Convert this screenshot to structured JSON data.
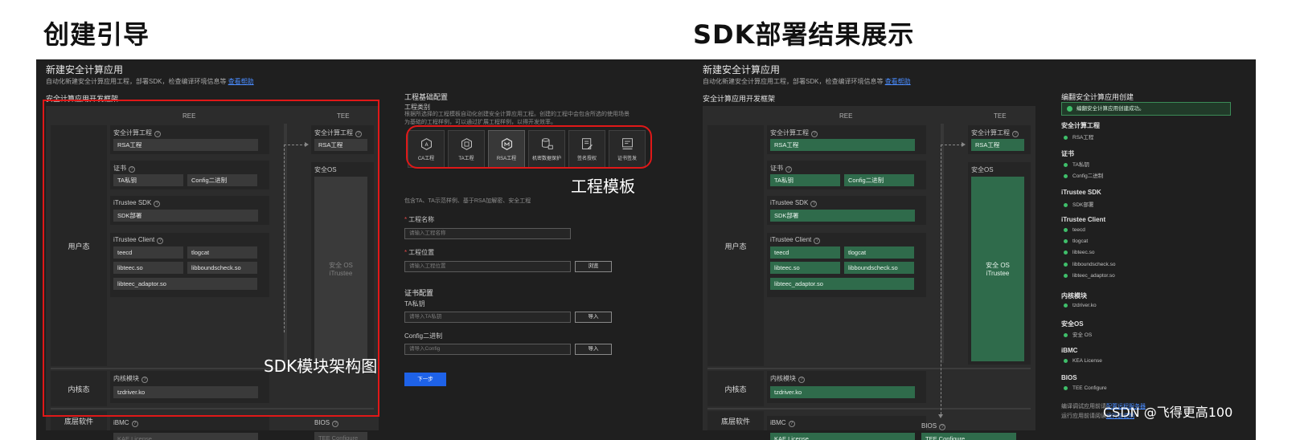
{
  "headings": {
    "left": "创建引导",
    "right": "SDK部署结果展示"
  },
  "dialog": {
    "title": "新建安全计算应用",
    "desc": "自动化新建安全计算应用工程，部署SDK，检查编译环境信息等",
    "help_link": "查看帮助",
    "framework_title": "安全计算应用开发框架"
  },
  "framework": {
    "ree": "REE",
    "tee": "TEE",
    "rows": {
      "user": "用户态",
      "kernel": "内核态",
      "base": "底层软件"
    },
    "labels": {
      "app_project": "安全计算工程",
      "cert": "证书",
      "sdk": "iTrustee SDK",
      "client": "iTrustee Client",
      "kernel_module": "内核模块",
      "ibmc": "iBMC",
      "tee_app_project": "安全计算工程",
      "secure_os": "安全OS",
      "bios": "BIOS"
    },
    "values": {
      "rsa": "RSA工程",
      "ta_private_key": "TA私钥",
      "config_bin": "Config二进制",
      "sdk_deploy": "SDK部署",
      "teecd": "teecd",
      "tlogcat": "tlogcat",
      "libteec": "libteec.so",
      "libboundscheck": "libboundscheck.so",
      "libteec_adaptor": "libteec_adaptor.so",
      "tzdriver": "tzdriver.ko",
      "kae": "KAE License",
      "tee_rsa": "RSA工程",
      "secure_os_line1": "安全 OS",
      "secure_os_line2": "iTrustee",
      "bios_val": "TEE Configure"
    }
  },
  "annotations": {
    "templates": "工程模板",
    "sdk_arch": "SDK模块架构图"
  },
  "config": {
    "title": "工程基础配置",
    "type_label": "工程类别",
    "type_desc_1": "根据所选择的工程模板自动化创建安全计算应用工程。创建的工程中会包含所选的使用场景",
    "type_desc_2": "为基础的工程样例，可以通过扩展工程样例，以得开发效率。",
    "templates": [
      "CA工程",
      "TA工程",
      "RSA工程",
      "机密数据保护",
      "签名授权",
      "证书签发"
    ],
    "template_note": "包含TA、TA示范样例、基于RSA加解密、安全工程",
    "name_label": "工程名称",
    "name_placeholder": "请输入工程名称",
    "location_label": "工程位置",
    "location_placeholder": "请输入工程位置",
    "browse": "浏览",
    "cert_title": "证书配置",
    "ta_key_label": "TA私钥",
    "ta_key_placeholder": "请导入TA私钥",
    "import": "导入",
    "config_label": "Config二进制",
    "config_placeholder": "请导入Config",
    "next": "下一步"
  },
  "result": {
    "title": "编翻安全计算应用创建",
    "banner": "编翻安全计算应用创建成功。",
    "sections": [
      {
        "title": "安全计算工程",
        "items": [
          "RSA工程"
        ]
      },
      {
        "title": "证书",
        "items": [
          "TA私钥",
          "Config二进制"
        ]
      },
      {
        "title": "iTrustee SDK",
        "items": [
          "SDK部署"
        ]
      },
      {
        "title": "iTrustee Client",
        "items": [
          "teecd",
          "tlogcat",
          "libteec.so",
          "libboundscheck.so",
          "libteec_adaptor.so"
        ]
      },
      {
        "title": "内核模块",
        "items": [
          "tzdriver.ko"
        ]
      },
      {
        "title": "安全OS",
        "items": [
          "安全 OS"
        ]
      },
      {
        "title": "iBMC",
        "items": [
          "KEA License"
        ]
      },
      {
        "title": "BIOS",
        "items": [
          "TEE Configure"
        ]
      }
    ],
    "note1_prefix": "编译调试应用前请",
    "note1_link": "配置远程服务器",
    "note2_prefix": "运行应用前请阅读",
    "note2_link": "运行前说明"
  },
  "watermark": "CSDN @飞得更高100",
  "colors": {
    "panel": "#1f1f1f",
    "deployed": "#2f6b4b",
    "accent": "#1e62e8",
    "highlight": "#e01818",
    "success": "#3fbf6a"
  }
}
